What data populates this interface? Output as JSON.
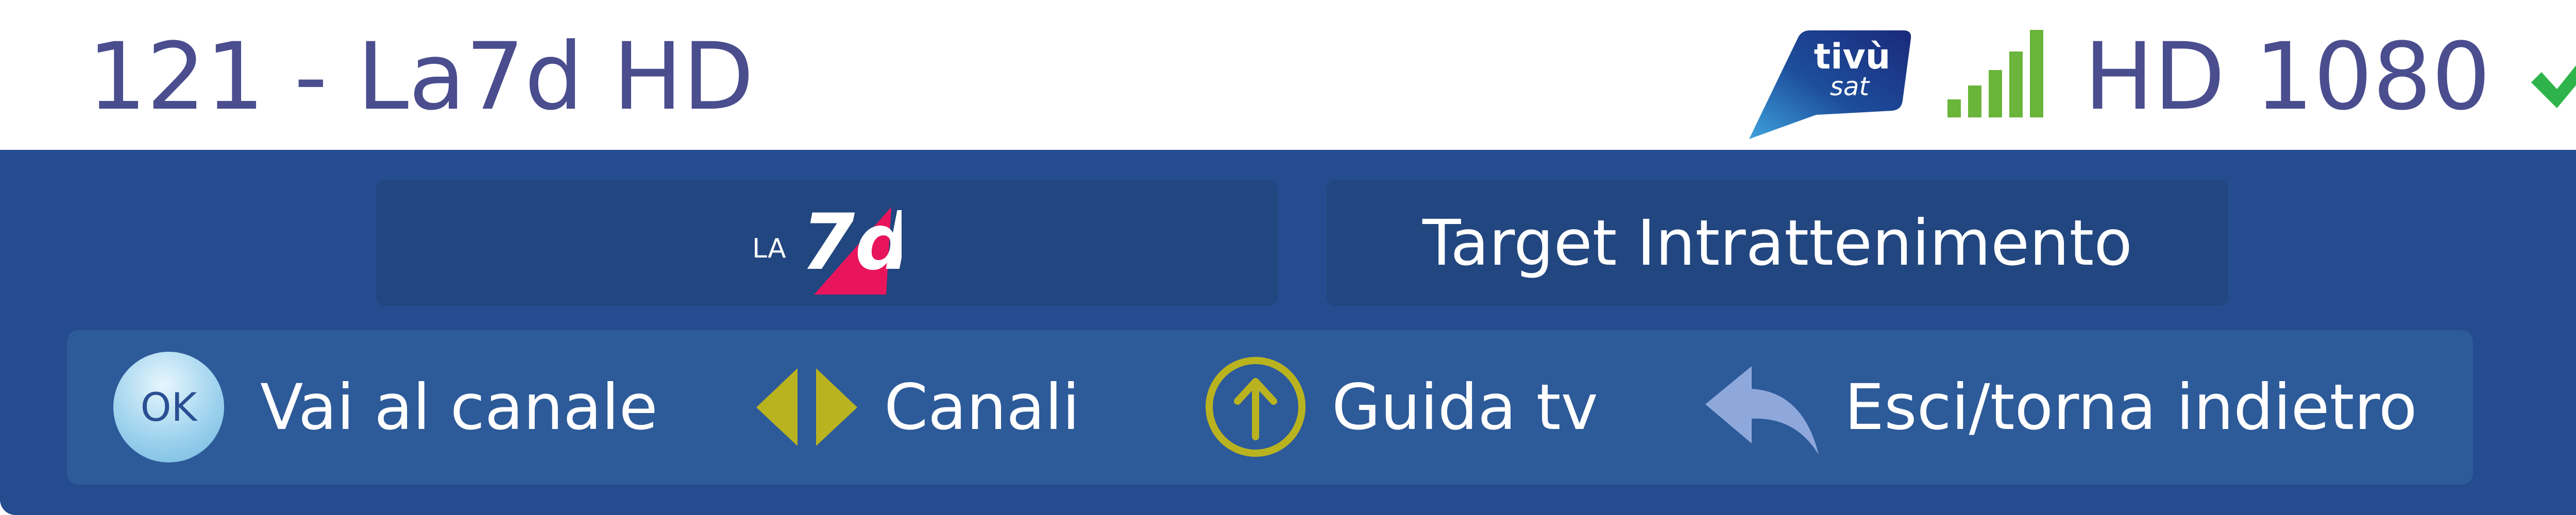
{
  "header": {
    "channel_title": "121 - La7d HD",
    "platform_logo_top": "tivù",
    "platform_logo_bottom": "sat",
    "resolution": "HD 1080"
  },
  "channel": {
    "logo_text_prefix": "LA",
    "logo_text_mark": "7d",
    "target": "Target Intrattenimento"
  },
  "hints": [
    {
      "key_label": "OK",
      "label": "Vai al canale",
      "icon": "ok-button-icon"
    },
    {
      "label": "Canali",
      "icon": "left-right-arrows-icon"
    },
    {
      "label": "Guida tv",
      "icon": "circle-up-arrow-icon"
    },
    {
      "label": "Esci/torna indietro",
      "icon": "back-arrow-icon"
    }
  ],
  "colors": {
    "title_text": "#4a4e8e",
    "panel_bg": "#244c8f",
    "box_bg": "#22467f",
    "hint_bar_bg": "#2d5a99",
    "signal_green": "#6ab53a",
    "arrow_yellow": "#b9b320",
    "check_green": "#2eb44a",
    "logo_pink": "#e8155c"
  }
}
